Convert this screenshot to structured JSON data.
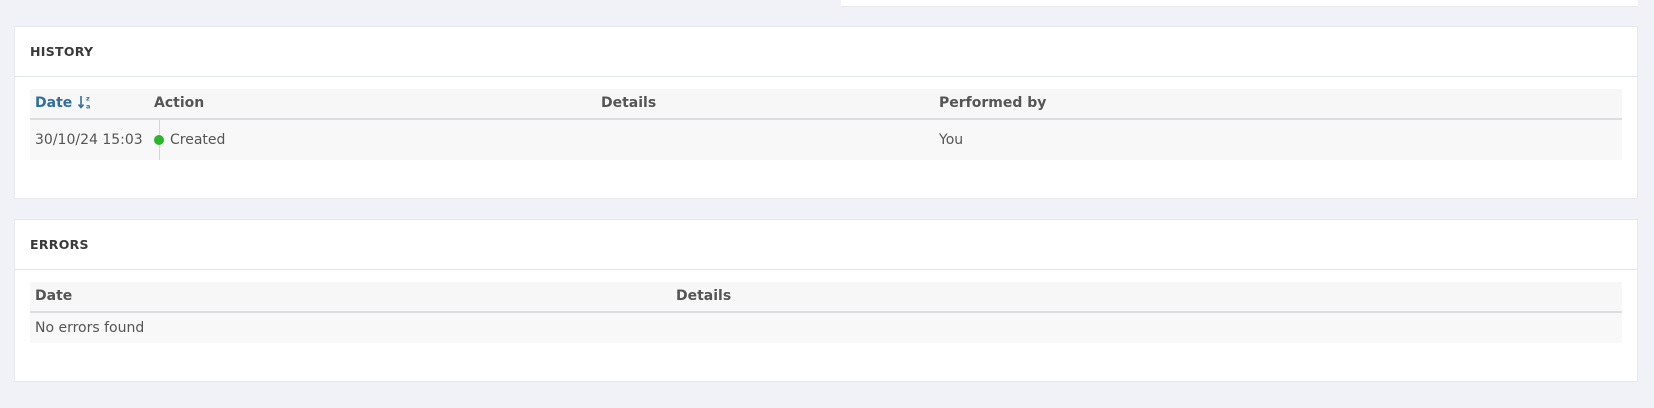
{
  "history": {
    "title": "HISTORY",
    "columns": {
      "date": "Date",
      "action": "Action",
      "details": "Details",
      "performed_by": "Performed by"
    },
    "rows": [
      {
        "date": "30/10/24 15:03",
        "action": "Created",
        "details": "",
        "performed_by": "You",
        "status_color": "#2ab52a"
      }
    ]
  },
  "errors": {
    "title": "ERRORS",
    "columns": {
      "date": "Date",
      "details": "Details"
    },
    "empty_message": "No errors found"
  },
  "colors": {
    "accent": "#2f6e9e",
    "status_created": "#2ab52a",
    "background": "#f0f2f7"
  }
}
